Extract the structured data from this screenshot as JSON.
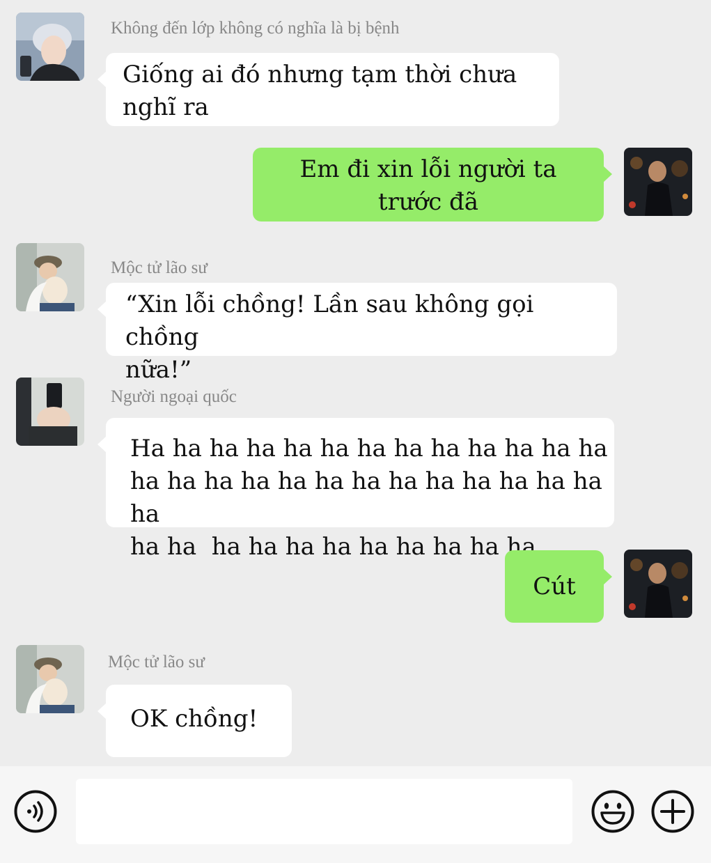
{
  "messages": [
    {
      "side": "left",
      "sender": "Không đến lớp không có nghĩa là bị bệnh",
      "avatar_icon": "avatar-silver-hair-icon",
      "lines": [
        "Giống ai đó nhưng tạm thời chưa",
        "nghĩ ra"
      ]
    },
    {
      "side": "right",
      "avatar_icon": "avatar-night-street-icon",
      "lines": [
        "Em đi xin lỗi người ta",
        "trước đã"
      ]
    },
    {
      "side": "left",
      "sender": "Mộc tử lão sư",
      "avatar_icon": "avatar-bucket-hat-teddy-icon",
      "lines": [
        "“Xin lỗi chồng! Lần sau không gọi chồng",
        "nữa!”"
      ]
    },
    {
      "side": "left",
      "sender": "Người ngoại quốc",
      "avatar_icon": "avatar-mirror-selfie-icon",
      "lines": [
        "Ha ha ha ha ha ha ha ha ha ha ha ha ha",
        "ha ha ha ha ha ha ha ha ha ha ha ha ha ha",
        "ha ha  ha ha ha ha ha ha ha ha ha"
      ]
    },
    {
      "side": "right",
      "avatar_icon": "avatar-night-street-icon",
      "lines": [
        "Cút"
      ]
    },
    {
      "side": "left",
      "sender": "Mộc tử lão sư",
      "avatar_icon": "avatar-bucket-hat-teddy-icon",
      "lines": [
        "OK chồng!"
      ]
    }
  ],
  "input_bar": {
    "voice_icon": "voice-icon",
    "emoji_icon": "emoji-icon",
    "plus_icon": "plus-icon",
    "text_value": ""
  },
  "colors": {
    "background": "#ededed",
    "bubble_other": "#ffffff",
    "bubble_self": "#95ec69",
    "name_text": "#888888",
    "input_bar": "#f6f6f6"
  }
}
